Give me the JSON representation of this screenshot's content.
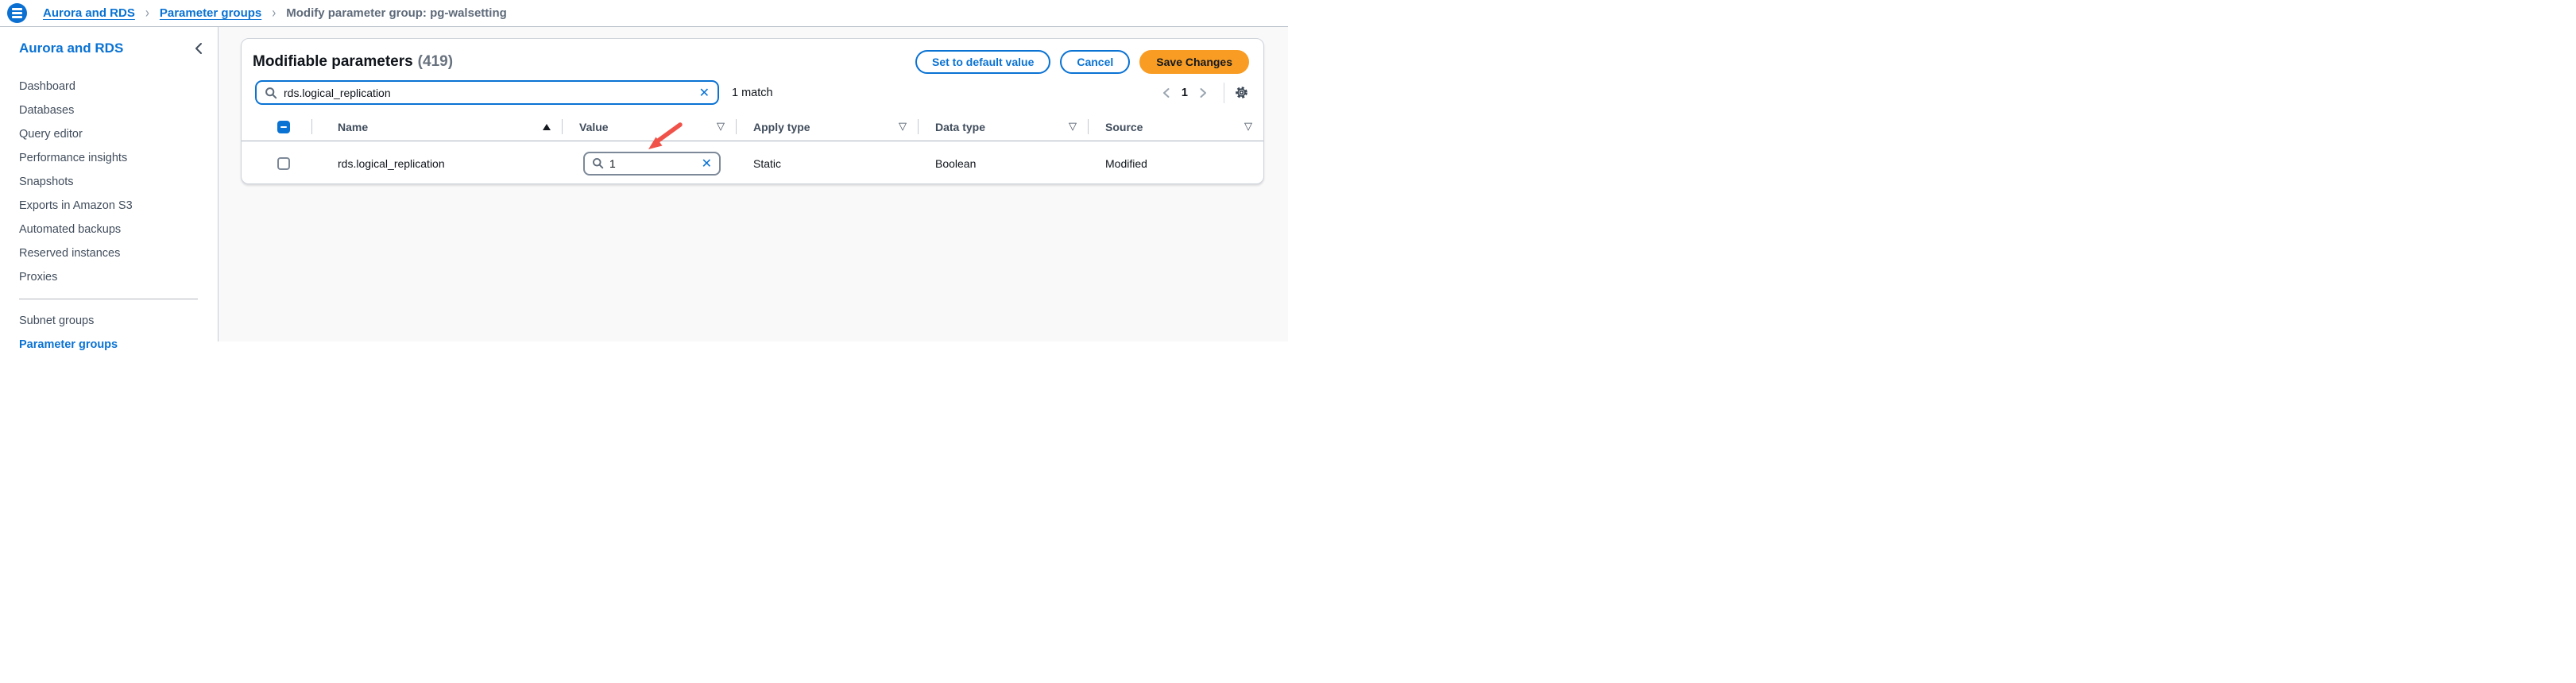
{
  "topbar": {
    "breadcrumbs": [
      {
        "label": "Aurora and RDS"
      },
      {
        "label": "Parameter groups"
      },
      {
        "label": "Modify parameter group: pg-walsetting"
      }
    ]
  },
  "sidebar": {
    "title": "Aurora and RDS",
    "items": [
      "Dashboard",
      "Databases",
      "Query editor",
      "Performance insights",
      "Snapshots",
      "Exports in Amazon S3",
      "Automated backups",
      "Reserved instances",
      "Proxies"
    ],
    "secondary_items": [
      "Subnet groups",
      "Parameter groups"
    ]
  },
  "panel": {
    "title": "Modifiable parameters",
    "count": "(419)",
    "actions": {
      "set_default": "Set to default value",
      "cancel": "Cancel",
      "save": "Save Changes"
    },
    "search": {
      "value": "rds.logical_replication",
      "match_text": "1 match"
    },
    "pagination": {
      "current_page": "1"
    },
    "table": {
      "headers": {
        "name": "Name",
        "value": "Value",
        "apply_type": "Apply type",
        "data_type": "Data type",
        "source": "Source"
      },
      "sort": {
        "column": "Name",
        "direction": "ascending"
      },
      "row": {
        "name": "rds.logical_replication",
        "value": "1",
        "apply_type": "Static",
        "data_type": "Boolean",
        "source": "Modified"
      }
    }
  },
  "icons": {
    "clear": "✕",
    "filter": "▽"
  },
  "colors": {
    "accent": "#0972d3",
    "link": "#0972d3",
    "primary_button": "#f89c24",
    "annotation_arrow": "#f0524a"
  }
}
